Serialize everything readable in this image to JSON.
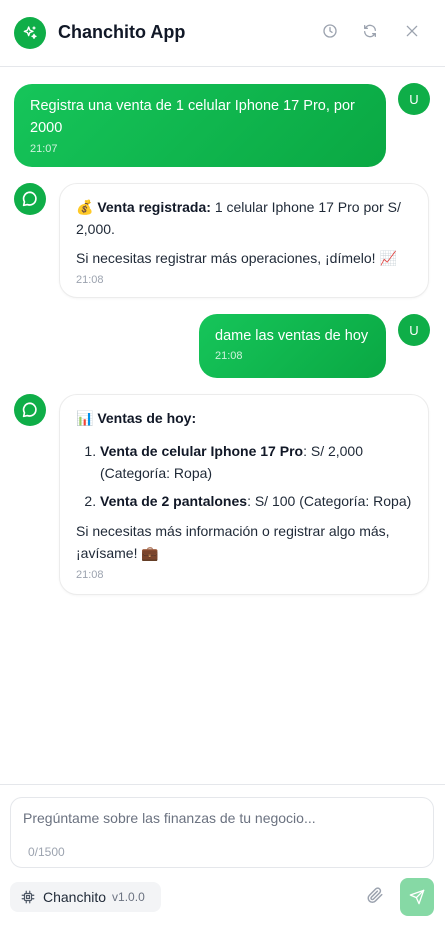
{
  "header": {
    "title": "Chanchito App",
    "icons": [
      "sparkles-icon",
      "history-icon",
      "refresh-icon",
      "close-icon"
    ]
  },
  "messages": [
    {
      "role": "user",
      "avatar": "U",
      "text": "Registra una venta de 1 celular Iphone 17 Pro, por 2000",
      "time": "21:07"
    },
    {
      "role": "bot",
      "emoji": "💰",
      "bold": "Venta registrada:",
      "text": " 1 celular Iphone 17 Pro por S/ 2,000.",
      "line2": "Si necesitas registrar más operaciones, ¡dímelo! 📈",
      "time": "21:08"
    },
    {
      "role": "user",
      "avatar": "U",
      "text": "dame las ventas de hoy",
      "time": "21:08"
    },
    {
      "role": "bot",
      "emoji": "📊",
      "bold": "Ventas de hoy:",
      "items": [
        {
          "bold": "Venta de celular Iphone 17 Pro",
          "text": ": S/ 2,000 (Categoría: Ropa)"
        },
        {
          "bold": "Venta de 2 pantalones",
          "text": ": S/ 100 (Categoría: Ropa)"
        }
      ],
      "footer": "Si necesitas más información o registrar algo más, ¡avísame! 💼",
      "time": "21:08"
    }
  ],
  "composer": {
    "placeholder": "Pregúntame sobre las finanzas de tu negocio...",
    "value": "",
    "counter": "0/1500"
  },
  "brand": {
    "name": "Chanchito",
    "version": "v1.0.0"
  },
  "colors": {
    "accent": "#0fae48",
    "send_disabled": "#86d9a5"
  }
}
